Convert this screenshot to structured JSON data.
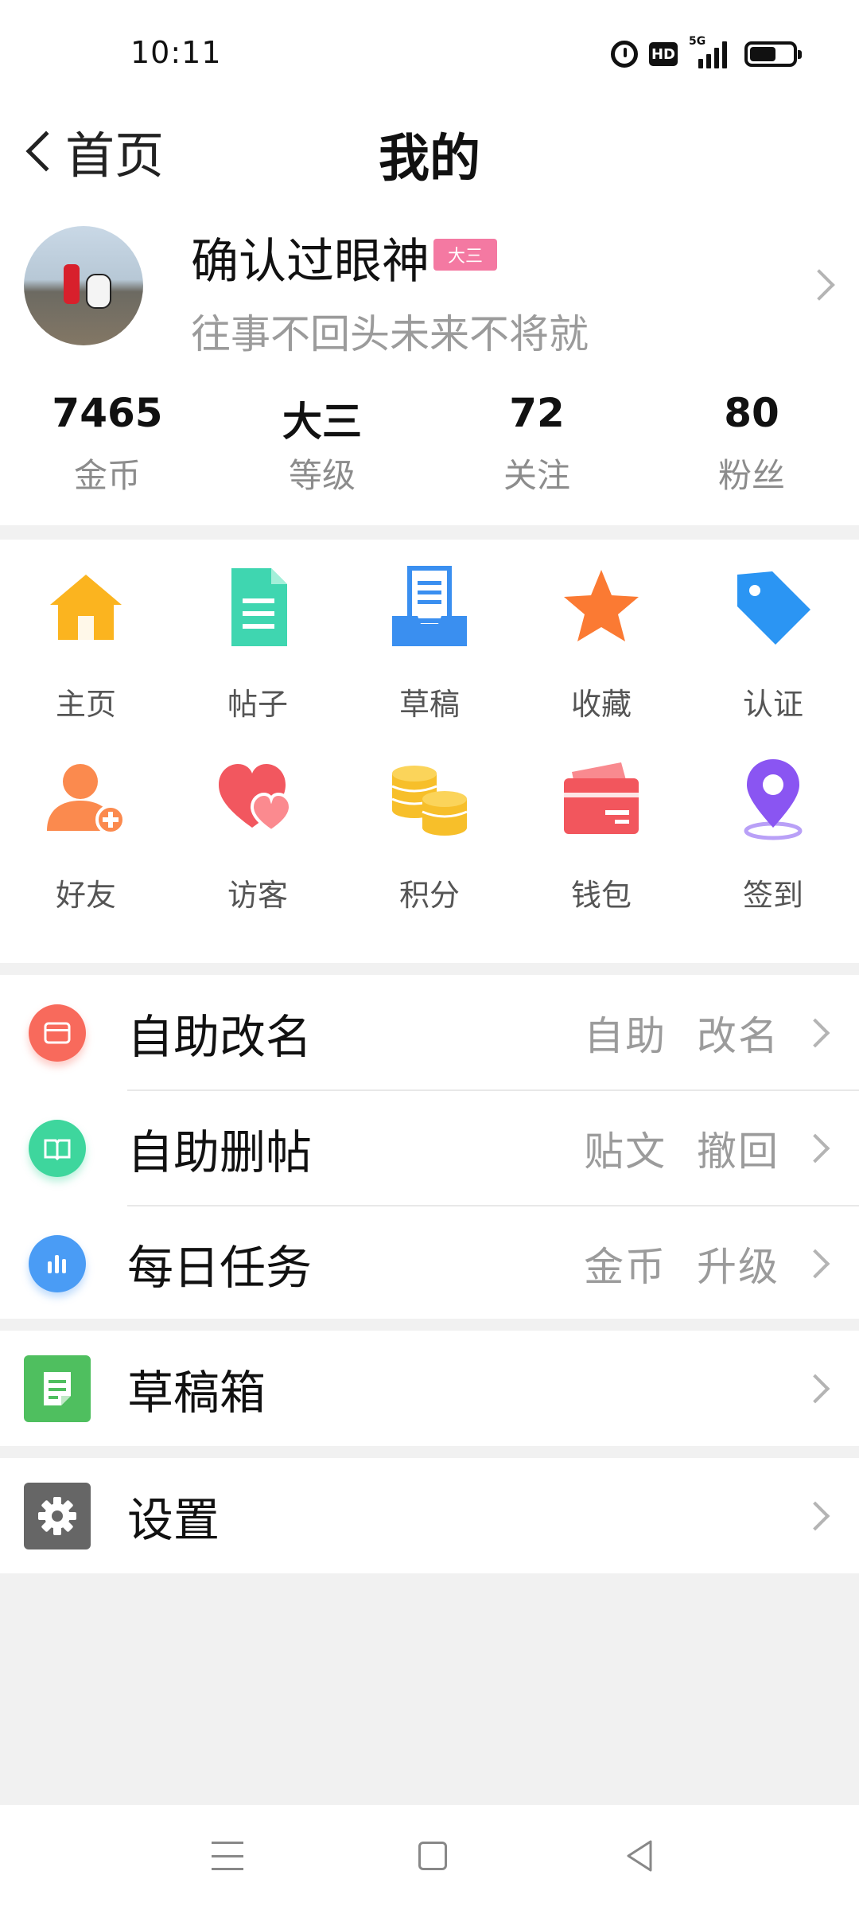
{
  "status_bar": {
    "time": "10:11",
    "network": "5G",
    "hd": "HD"
  },
  "navbar": {
    "back_label": "首页",
    "title": "我的"
  },
  "profile": {
    "username": "确认过眼神",
    "level_badge": "大三",
    "signature": "往事不回头未来不将就"
  },
  "stats": [
    {
      "value": "7465",
      "label": "金币"
    },
    {
      "value": "大三",
      "label": "等级"
    },
    {
      "value": "72",
      "label": "关注"
    },
    {
      "value": "80",
      "label": "粉丝"
    }
  ],
  "grid_row1": [
    {
      "label": "主页",
      "icon": "home-icon"
    },
    {
      "label": "帖子",
      "icon": "document-icon"
    },
    {
      "label": "草稿",
      "icon": "drafts-tray-icon"
    },
    {
      "label": "收藏",
      "icon": "star-icon"
    },
    {
      "label": "认证",
      "icon": "tag-icon"
    }
  ],
  "grid_row2": [
    {
      "label": "好友",
      "icon": "add-friend-icon"
    },
    {
      "label": "访客",
      "icon": "hearts-icon"
    },
    {
      "label": "积分",
      "icon": "coins-icon"
    },
    {
      "label": "钱包",
      "icon": "wallet-icon"
    },
    {
      "label": "签到",
      "icon": "location-pin-icon"
    }
  ],
  "menu": [
    {
      "label": "自助改名",
      "tag": "自助 改名",
      "icon": "wallet-small-icon"
    },
    {
      "label": "自助删帖",
      "tag": "贴文 撤回",
      "icon": "book-icon"
    },
    {
      "label": "每日任务",
      "tag": "金币 升级",
      "icon": "bar-chart-icon"
    }
  ],
  "drafts_box": {
    "label": "草稿箱",
    "icon": "draft-note-icon"
  },
  "settings": {
    "label": "设置",
    "icon": "gear-icon"
  },
  "colors": {
    "badge": "#f479a2",
    "home": "#fbb41f",
    "document": "#3fd6b0",
    "tray": "#3a8ff0",
    "star": "#fb7a33",
    "tag": "#2b95f3",
    "friend": "#fb8a4e",
    "hearts": "#f2575f",
    "coins": "#f7bf2a",
    "wallet": "#f2565d",
    "pin": "#8a55f2",
    "drafts_green": "#4fbf5f",
    "settings_gray": "#666666"
  }
}
